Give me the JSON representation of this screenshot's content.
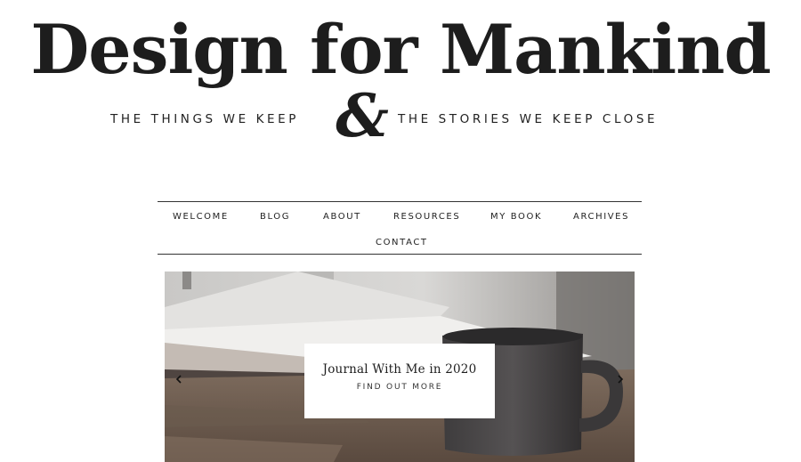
{
  "site": {
    "title": "Design for Mankind",
    "tagline_left": "THE THINGS WE KEEP",
    "ampersand": "&",
    "tagline_right": "THE STORIES WE KEEP CLOSE"
  },
  "nav": {
    "items": [
      {
        "label": "WELCOME"
      },
      {
        "label": "BLOG"
      },
      {
        "label": "ABOUT"
      },
      {
        "label": "RESOURCES"
      },
      {
        "label": "MY BOOK"
      },
      {
        "label": "ARCHIVES"
      },
      {
        "label": "CONTACT"
      }
    ]
  },
  "hero": {
    "slide_title": "Journal With Me in 2020",
    "slide_cta": "FIND OUT MORE",
    "prev_icon": "chevron-left-icon",
    "next_icon": "chevron-right-icon"
  }
}
